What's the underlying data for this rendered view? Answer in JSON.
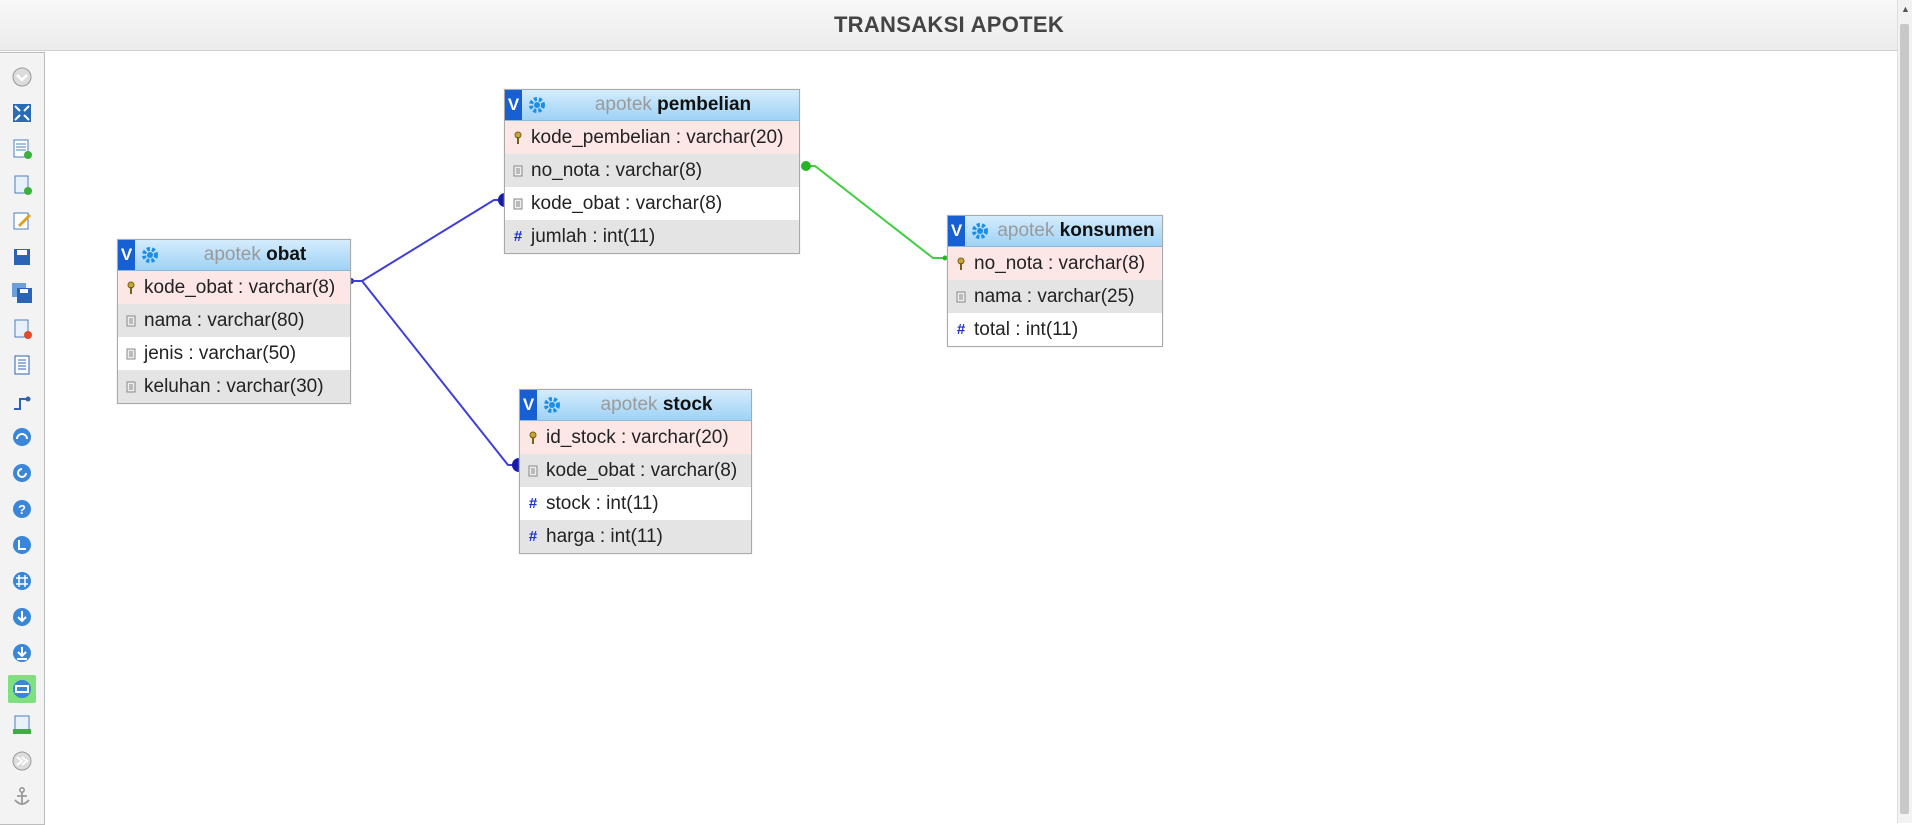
{
  "window": {
    "title": "TRANSAKSI APOTEK"
  },
  "toolbar": {
    "tools": [
      "collapse-all-icon",
      "fit-to-screen-icon",
      "add-table-icon",
      "add-page-icon",
      "edit-icon",
      "save-icon",
      "save-as-icon",
      "delete-page-icon",
      "page-list-icon",
      "toggle-relations-icon",
      "toggle-angular-icon",
      "refresh-icon",
      "help-icon",
      "toggle-lines-icon",
      "toggle-grid-icon",
      "move-down-icon",
      "export-icon",
      "toggle-full-mode-icon",
      "export-document-icon",
      "expand-all-icon",
      "anchor-icon"
    ],
    "active_tool": "toggle-full-mode-icon"
  },
  "tables": {
    "obat": {
      "db": "apotek",
      "name": "obat",
      "columns": [
        {
          "text": "kode_obat : varchar(8)",
          "kind": "pk"
        },
        {
          "text": "nama : varchar(80)",
          "kind": "col"
        },
        {
          "text": "jenis : varchar(50)",
          "kind": "col"
        },
        {
          "text": "keluhan : varchar(30)",
          "kind": "col"
        }
      ]
    },
    "pembelian": {
      "db": "apotek",
      "name": "pembelian",
      "columns": [
        {
          "text": "kode_pembelian : varchar(20)",
          "kind": "pk"
        },
        {
          "text": "no_nota : varchar(8)",
          "kind": "col"
        },
        {
          "text": "kode_obat : varchar(8)",
          "kind": "col"
        },
        {
          "text": "jumlah : int(11)",
          "kind": "num"
        }
      ]
    },
    "konsumen": {
      "db": "apotek",
      "name": "konsumen",
      "columns": [
        {
          "text": "no_nota : varchar(8)",
          "kind": "pk"
        },
        {
          "text": "nama : varchar(25)",
          "kind": "col"
        },
        {
          "text": "total : int(11)",
          "kind": "num"
        }
      ]
    },
    "stock": {
      "db": "apotek",
      "name": "stock",
      "columns": [
        {
          "text": "id_stock : varchar(20)",
          "kind": "pk"
        },
        {
          "text": "kode_obat : varchar(8)",
          "kind": "col"
        },
        {
          "text": "stock : int(11)",
          "kind": "num"
        },
        {
          "text": "harga : int(11)",
          "kind": "num"
        }
      ]
    }
  },
  "relation_colors": {
    "obat_links": "#3f3fd8",
    "nota_link": "#3fcf3f"
  },
  "v_label": "V"
}
